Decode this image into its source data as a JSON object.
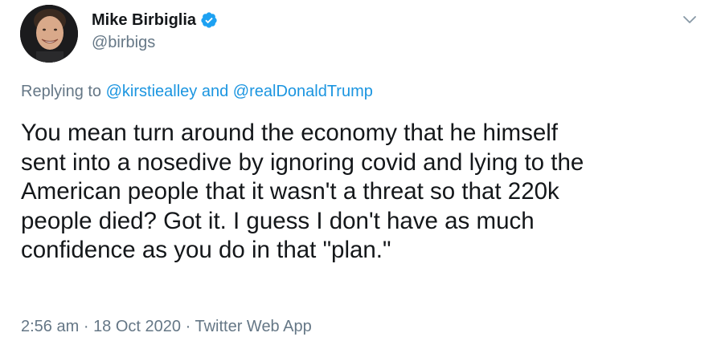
{
  "author": {
    "display_name": "Mike Birbiglia",
    "handle": "@birbigs",
    "verified": true,
    "verified_color": "#1da1f2"
  },
  "reply": {
    "prefix": "Replying to",
    "mention_1": "@kirstiealley",
    "conjunction": "and",
    "mention_2": "@realDonaldTrump",
    "mention_color": "#1b95e0"
  },
  "tweet": {
    "lines": [
      "You mean turn around the economy that he himself",
      "sent into a nosedive by ignoring covid and lying to the",
      "American people that it wasn't a threat so that 220k",
      "people died? Got it. I guess I don't have as much",
      "confidence as you do in that \"plan.\""
    ]
  },
  "meta": {
    "time": "2:56 am",
    "separator_1": "·",
    "date": "18 Oct 2020",
    "separator_2": "·",
    "source": "Twitter Web App"
  },
  "icons": {
    "verified": "verified-badge-icon",
    "more": "chevron-down-icon"
  }
}
